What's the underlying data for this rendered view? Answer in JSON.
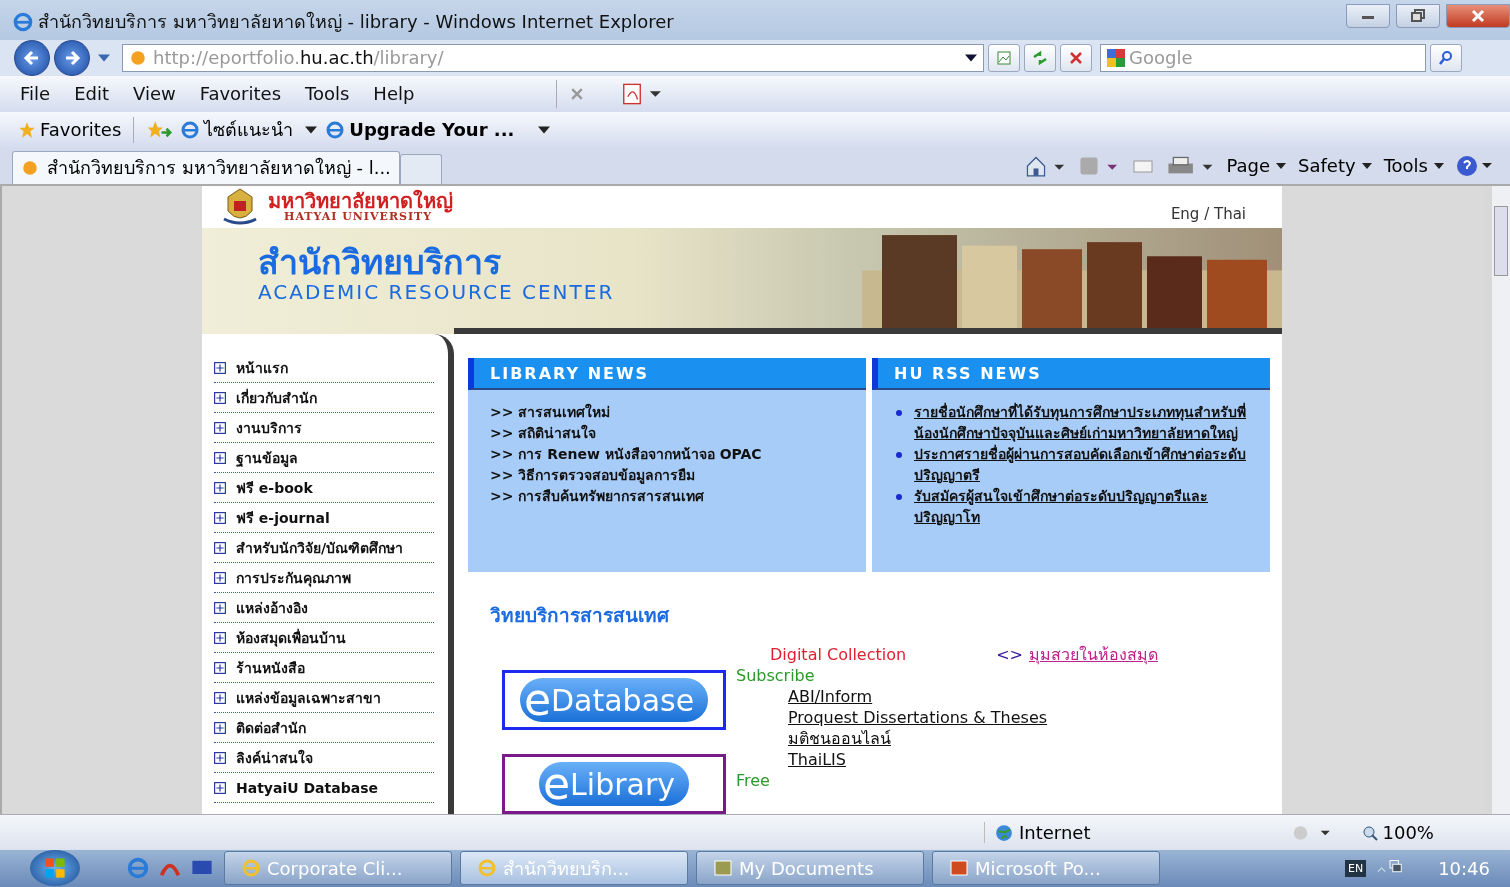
{
  "window": {
    "title": "สำนักวิทยบริการ มหาวิทยาลัยหาดใหญ่ - library - Windows Internet Explorer"
  },
  "address_bar": {
    "url_faded_start": "http://eportfolio.",
    "url_domain": "hu.ac.th",
    "url_faded_end": "/library/"
  },
  "search": {
    "placeholder": "Google"
  },
  "menu": [
    "File",
    "Edit",
    "View",
    "Favorites",
    "Tools",
    "Help"
  ],
  "favorites_bar": {
    "favorites": "Favorites",
    "items": [
      {
        "label": "ไซต์แนะนำ",
        "bold": false
      },
      {
        "label": "Upgrade Your ...",
        "bold": true
      }
    ]
  },
  "tabs": [
    {
      "label": "สำนักวิทยบริการ มหาวิทยาลัยหาดใหญ่ - l...",
      "selected": true
    }
  ],
  "command_bar": [
    "Page",
    "Safety",
    "Tools"
  ],
  "page": {
    "university_th": "มหาวิทยาลัยหาดใหญ่",
    "university_en": "HATYAI UNIVERSITY",
    "lang_switch": "Eng / Thai",
    "banner_th": "สำนักวิทยบริการ",
    "banner_en": "ACADEMIC RESOURCE CENTER",
    "sidebar": [
      "หน้าแรก",
      "เกี่ยวกับสำนัก",
      "งานบริการ",
      "ฐานข้อมูล",
      "ฟรี e-book",
      "ฟรี e-journal",
      "สำหรับนักวิจัย/บัณฑิตศึกษา",
      "การประกันคุณภาพ",
      "แหล่งอ้างอิง",
      "ห้องสมุดเพื่อนบ้าน",
      "ร้านหนังสือ",
      "แหล่งข้อมูลเฉพาะสาขา",
      "ติดต่อสำนัก",
      "ลิงค์น่าสนใจ",
      "HatyaiU Database"
    ],
    "library_news": {
      "title": "LIBRARY NEWS",
      "items": [
        ">> สารสนเทศใหม่",
        ">> สถิติน่าสนใจ",
        ">> การ Renew หนังสือจากหน้าจอ OPAC",
        ">> วิธีการตรวจสอบข้อมูลการยืม",
        ">> การสืบค้นทรัพยากรสารสนเทศ"
      ]
    },
    "rss_news": {
      "title": "HU RSS NEWS",
      "items": [
        "รายชื่อนักศึกษาที่ได้รับทุนการศึกษาประเภททุนสำหรับพี่น้องนักศึกษาปัจจุบันและศิษย์เก่ามหาวิทยาลัยหาดใหญ่",
        "ประกาศรายชื่อผู้ผ่านการสอบคัดเลือกเข้าศึกษาต่อระดับปริญญาตรี",
        "รับสมัครผู้สนใจเข้าศึกษาต่อระดับปริญญาตรีและปริญญาโท"
      ]
    },
    "services_title": "วิทยบริการสารสนเทศ",
    "digital_collection": "Digital Collection",
    "corner_marker": "<>",
    "corner_link": "มุมสวยในห้องสมุด",
    "edatabase_logo": {
      "letter": "e",
      "word": "Database"
    },
    "elibrary_logo": {
      "letter": "e",
      "word": "Library"
    },
    "subscribe": "Subscribe",
    "subscribe_links": [
      "ABI/Inform",
      "Proquest Dissertations & Theses",
      "มติชนออนไลน์",
      "ThaiLIS"
    ],
    "free": "Free"
  },
  "status_bar": {
    "zone": "Internet",
    "zoom": "100%"
  },
  "taskbar": {
    "tasks": [
      {
        "label": "Corporate Cli...",
        "kind": "ie",
        "selected": false
      },
      {
        "label": "สำนักวิทยบริก...",
        "kind": "ie",
        "selected": true
      },
      {
        "label": "My Documents",
        "kind": "folder",
        "selected": false
      },
      {
        "label": "Microsoft Po...",
        "kind": "ppt",
        "selected": false
      }
    ],
    "language": "EN",
    "time": "10:46"
  }
}
